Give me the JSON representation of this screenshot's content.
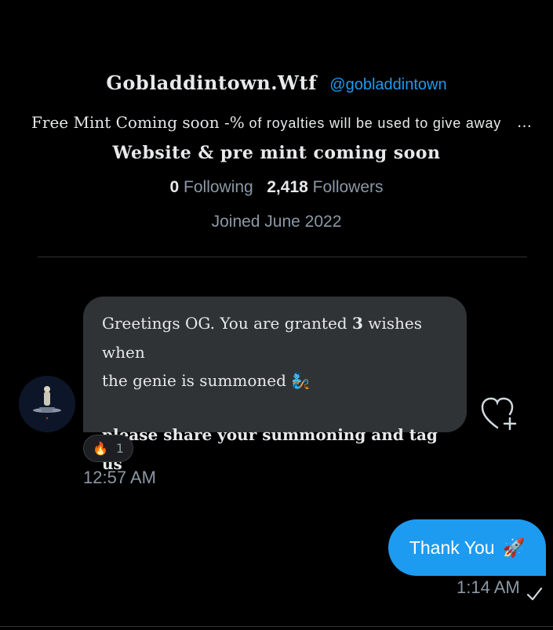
{
  "profile": {
    "display_name": "Gobladdintown.Wtf",
    "handle": "@gobladdintown",
    "bio_part1": "Free Mint Coming soon -%",
    "bio_part2": " of royalties will be used to give away ",
    "bio_more": "…",
    "tagline": "Website & pre mint coming soon",
    "following_count": "0",
    "following_label": "Following",
    "followers_count": "2,418",
    "followers_label": "Followers",
    "joined": "Joined June 2022"
  },
  "messages": {
    "incoming": {
      "text_a": "Greetings OG. You are granted ",
      "text_b": "3",
      "text_c": " wishes when",
      "text_d": "the genie is summoned 🧞 ",
      "text_e": "please share your summoning and tag us",
      "reaction_emoji": "🔥",
      "reaction_count": "1",
      "time": "12:57 AM"
    },
    "outgoing": {
      "text": "Thank You",
      "emoji": "🚀",
      "time": "1:14 AM"
    }
  },
  "colors": {
    "accent": "#1d9bf0",
    "bubble_incoming": "#2f3336",
    "muted_text": "#8b98a5",
    "background": "#000000"
  }
}
